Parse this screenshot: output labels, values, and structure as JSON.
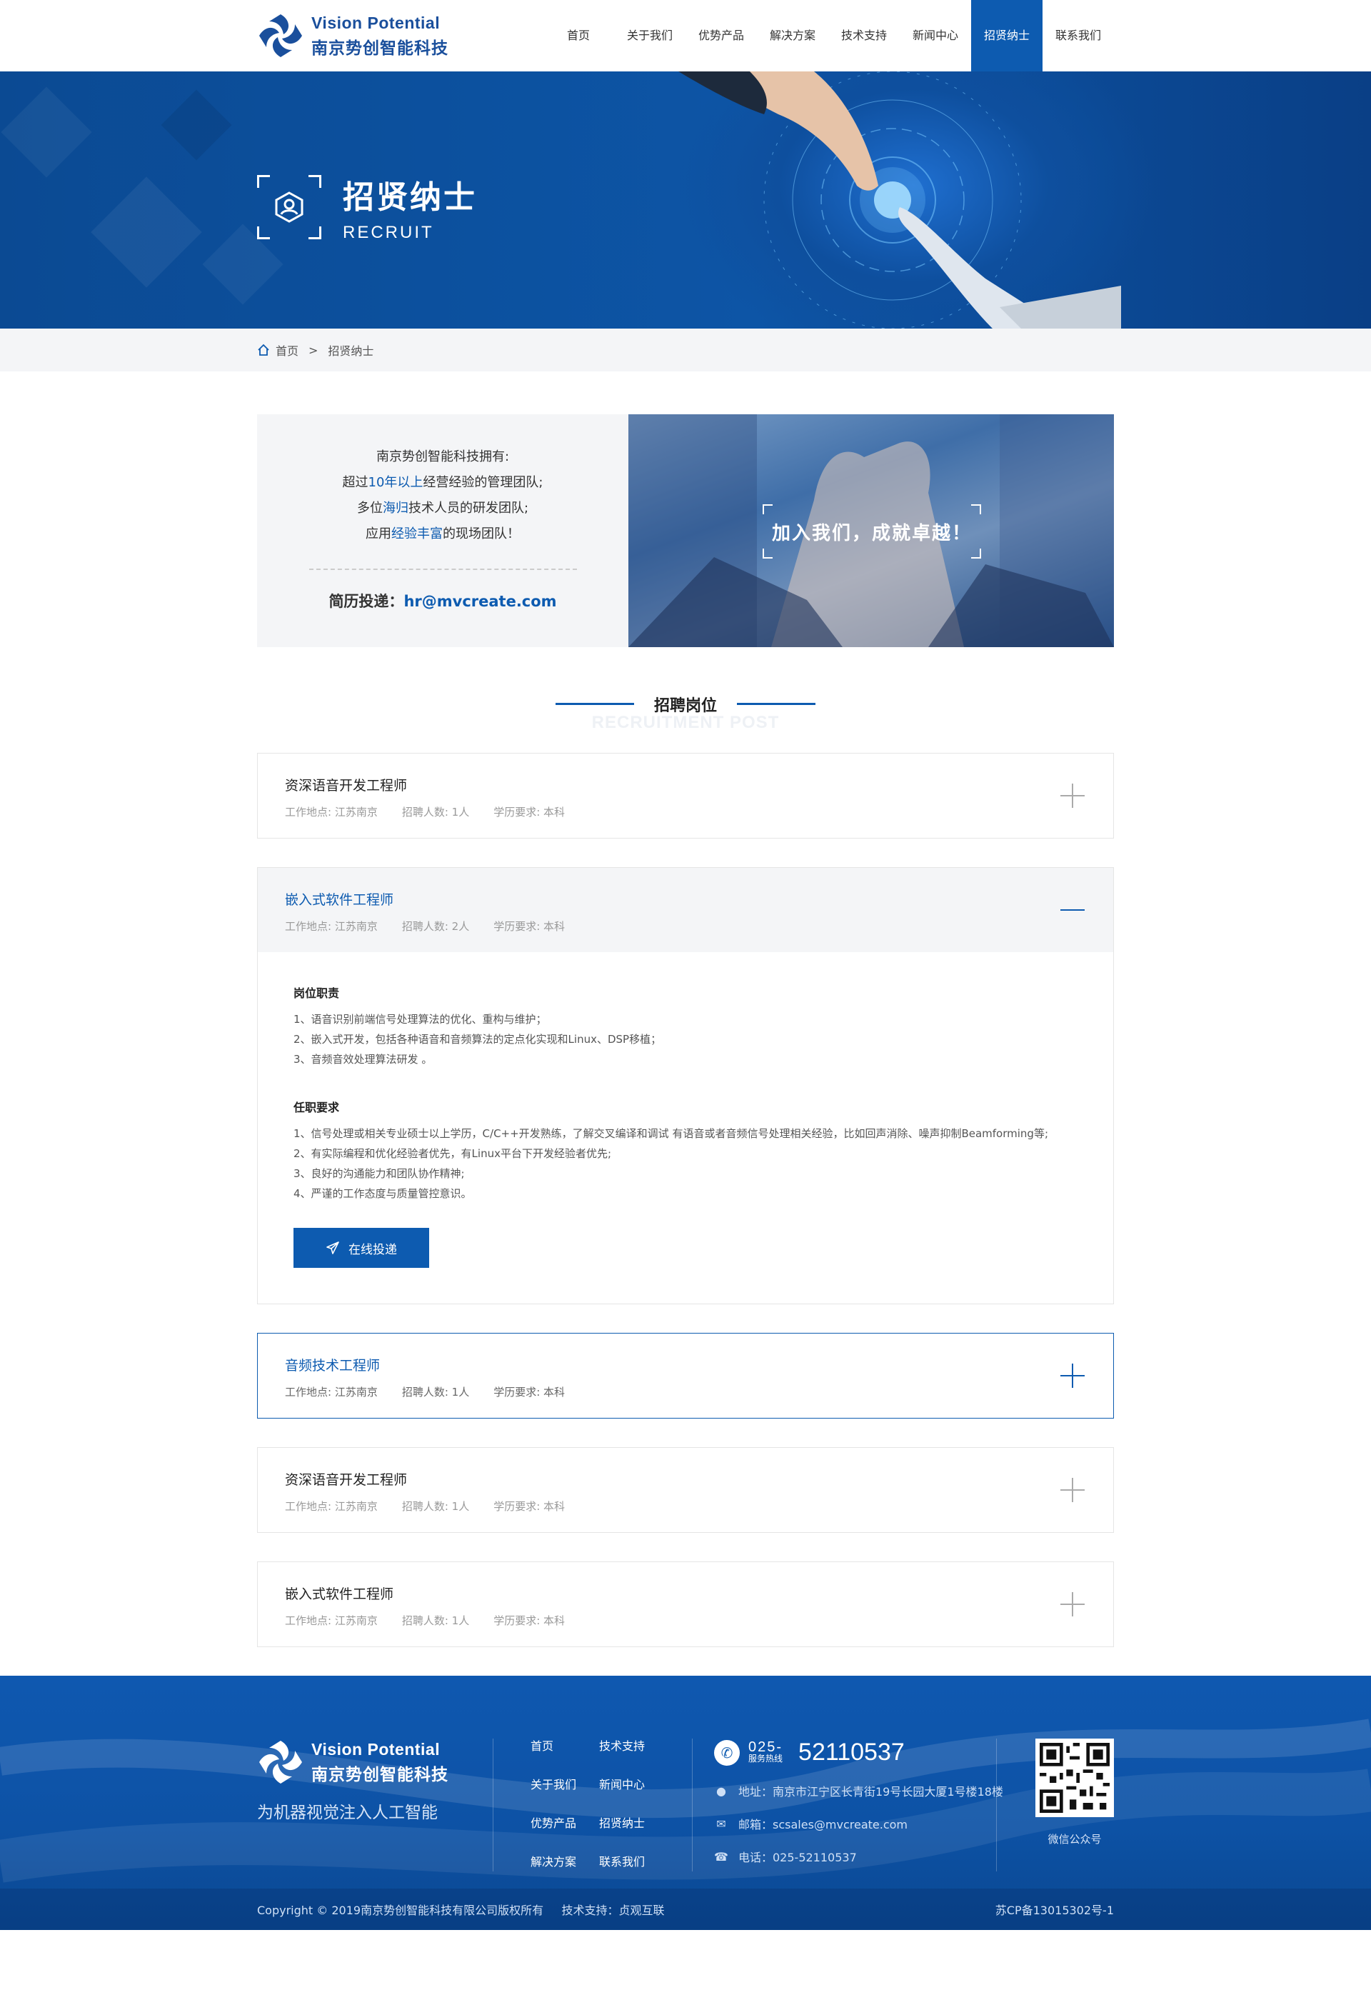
{
  "header": {
    "logo_en": "Vision Potential",
    "logo_cn": "南京势创智能科技",
    "nav": [
      "首页",
      "关于我们",
      "优势产品",
      "解决方案",
      "技术支持",
      "新闻中心",
      "招贤纳士",
      "联系我们"
    ],
    "active_nav": "招贤纳士"
  },
  "banner": {
    "title_cn": "招贤纳士",
    "title_en": "RECRUIT"
  },
  "breadcrumb": {
    "home": "首页",
    "separator": ">",
    "current": "招贤纳士"
  },
  "intro": {
    "line1": "南京势创智能科技拥有:",
    "line2_pre": "超过",
    "line2_hl": "10年以上",
    "line2_post": "经营经验的管理团队;",
    "line3_pre": "多位",
    "line3_hl": "海归",
    "line3_post": "技术人员的研发团队;",
    "line4_pre": "应用",
    "line4_hl": "经验丰富",
    "line4_post": "的现场团队！",
    "mail_label": "简历投递：",
    "mail": "hr@mvcreate.com",
    "slogan": "加入我们，成就卓越！"
  },
  "section": {
    "title_cn": "招聘岗位",
    "title_en": "RECRUITMENT POST"
  },
  "jobs": [
    {
      "title": "资深语音开发工程师",
      "location": "工作地点: 江苏南京",
      "count": "招聘人数: 1人",
      "edu": "学历要求: 本科",
      "state": "closed"
    },
    {
      "title": "嵌入式软件工程师",
      "location": "工作地点: 江苏南京",
      "count": "招聘人数: 2人",
      "edu": "学历要求: 本科",
      "state": "open",
      "duty_title": "岗位职责",
      "duties": [
        "1、语音识别前端信号处理算法的优化、重构与维护；",
        "2、嵌入式开发，包括各种语音和音频算法的定点化实现和Linux、DSP移植；",
        "3、音频音效处理算法研发 。"
      ],
      "req_title": "任职要求",
      "reqs": [
        "1、信号处理或相关专业硕士以上学历，C/C++开发熟练，了解交叉编译和调试 有语音或者音频信号处理相关经验，比如回声消除、噪声抑制Beamforming等;",
        "2、有实际编程和优化经验者优先，有Linux平台下开发经验者优先;",
        "3、良好的沟通能力和团队协作精神;",
        "4、严谨的工作态度与质量管控意识。"
      ],
      "apply": "在线投递"
    },
    {
      "title": "音频技术工程师",
      "location": "工作地点: 江苏南京",
      "count": "招聘人数: 1人",
      "edu": "学历要求: 本科",
      "state": "hover"
    },
    {
      "title": "资深语音开发工程师",
      "location": "工作地点: 江苏南京",
      "count": "招聘人数: 1人",
      "edu": "学历要求: 本科",
      "state": "closed"
    },
    {
      "title": "嵌入式软件工程师",
      "location": "工作地点: 江苏南京",
      "count": "招聘人数: 1人",
      "edu": "学历要求: 本科",
      "state": "closed"
    }
  ],
  "footer": {
    "logo_en": "Vision Potential",
    "logo_cn": "南京势创智能科技",
    "slogan": "为机器视觉注入人工智能",
    "links": [
      "首页",
      "技术支持",
      "关于我们",
      "新闻中心",
      "优势产品",
      "招贤纳士",
      "解决方案",
      "联系我们"
    ],
    "phone_area": "025-",
    "phone_label": "服务热线",
    "phone_number": "52110537",
    "address": "地址：南京市江宁区长青街19号长园大厦1号楼18楼",
    "email": "邮箱：scsales@mvcreate.com",
    "tel": "电话：025-52110537",
    "qr_label": "微信公众号",
    "copyright": "Copyright © 2019南京势创智能科技有限公司版权所有     技术支持：贞观互联",
    "icp": "苏CP备13015302号-1"
  },
  "colors": {
    "brand": "#0d5bb0",
    "banner": "#0d55a6",
    "light_bg": "#f4f5f7"
  }
}
